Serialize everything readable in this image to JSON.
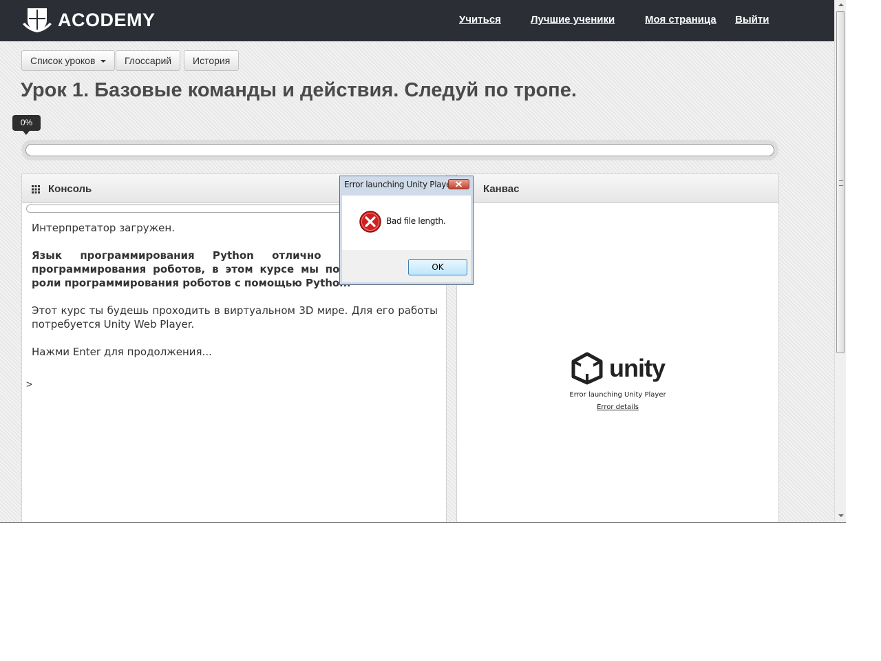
{
  "brand": {
    "name": "ACODEMY"
  },
  "nav": {
    "learn": "Учиться",
    "best_students": "Лучшие ученики",
    "my_page": "Моя страница",
    "logout": "Выйти"
  },
  "toolbar": {
    "lessons_list": "Список уроков",
    "glossary": "Глоссарий",
    "history": "История"
  },
  "lesson": {
    "title": "Урок 1. Базовые команды и действия. Следуй по тропе."
  },
  "progress": {
    "label": "0%",
    "value": 0
  },
  "console": {
    "title": "Консоль",
    "lines": [
      "Интерпретатор загружен.",
      "Язык программирования Python отлично подходит для программирования роботов, в этом курсе мы попробуем себя в роли программирования роботов с помощью Python.",
      "Этот курс ты будешь проходить в виртуальном 3D мире. Для его работы потребуется Unity Web Player.",
      "Нажми Enter для продолжения..."
    ],
    "prompt": ">"
  },
  "canvas": {
    "title": "Канвас",
    "unity_logo_text": "unity",
    "error_text": "Error launching Unity Player",
    "error_link": "Error details"
  },
  "dialog": {
    "title": "Error launching Unity Player",
    "message": "Bad file length.",
    "ok": "OK"
  },
  "colors": {
    "navbar": "#2b2f35",
    "error_red": "#d21f1f",
    "dialog_frame": "#cfdbe9"
  },
  "icons": {
    "dialog_error": "error-circle-icon",
    "close": "close-icon",
    "panel": "grid-icon"
  }
}
